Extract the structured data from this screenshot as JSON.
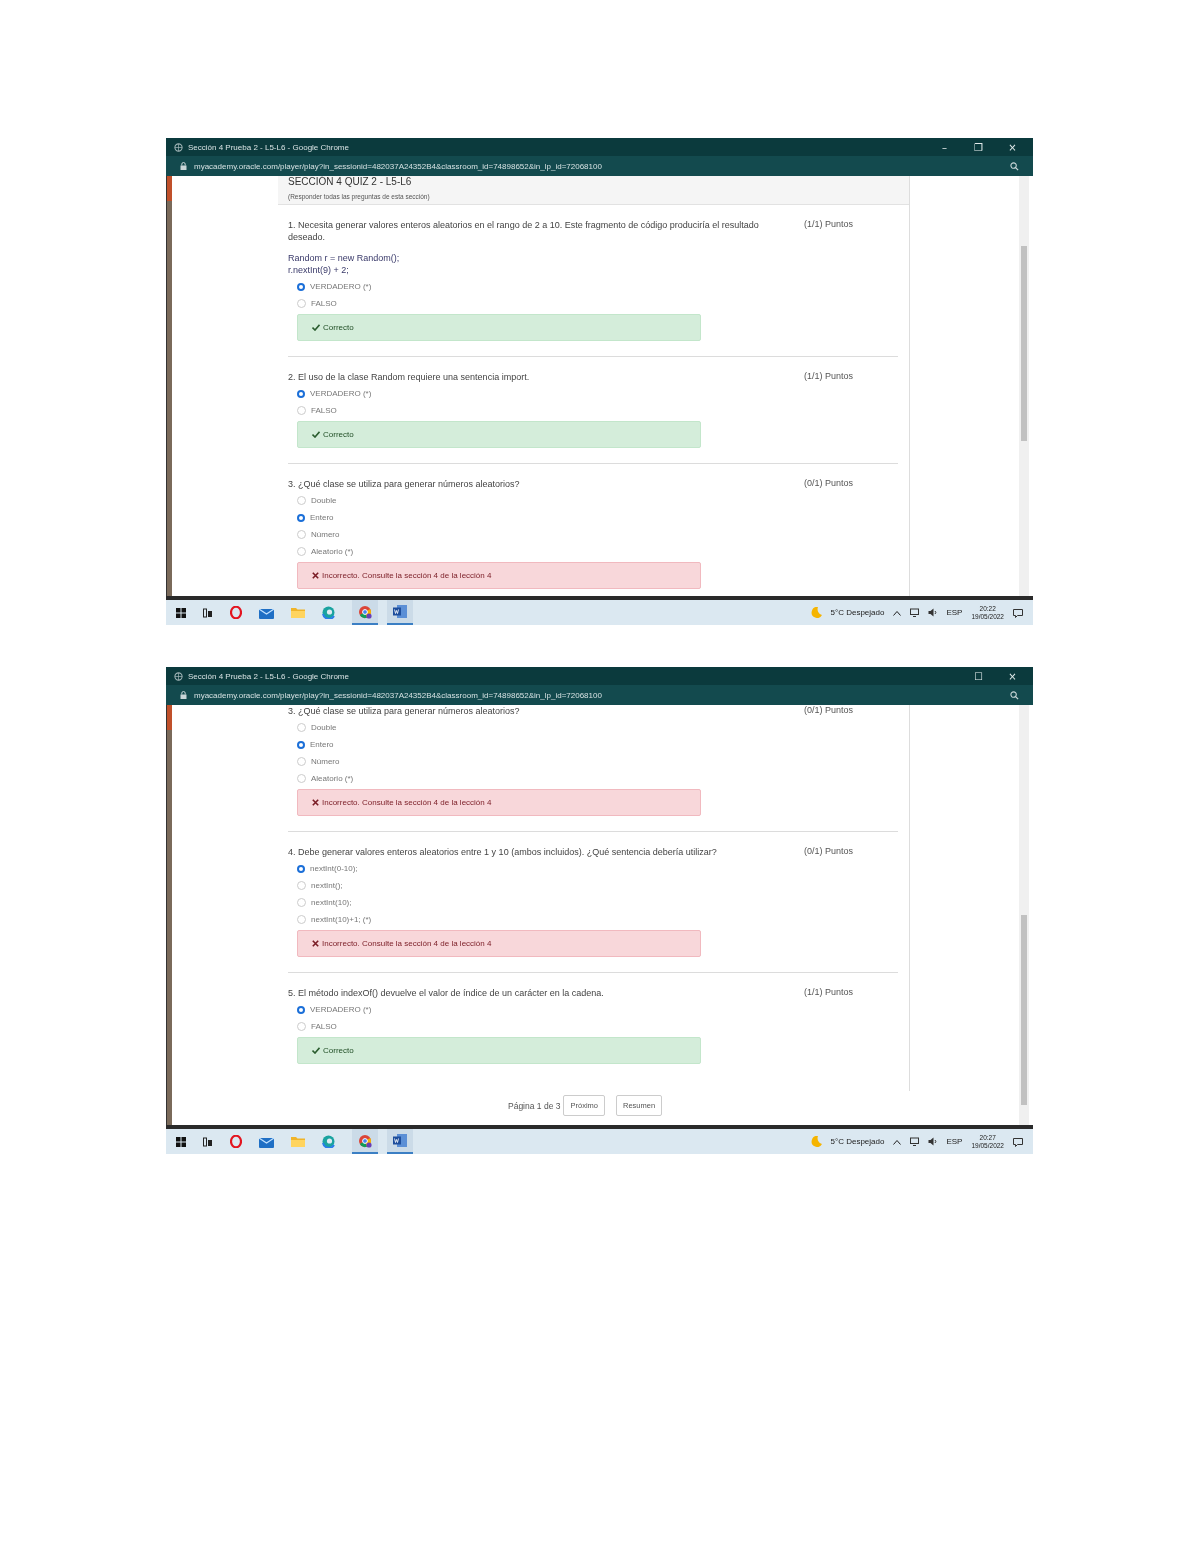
{
  "screenshots": [
    {
      "window": {
        "title": "Sección 4 Prueba 2 - L5-L6 - Google Chrome",
        "controls": [
          "–",
          "❐",
          "×"
        ]
      },
      "address": "myacademy.oracle.com/player/play?in_sessionid=482037A24352B4&classroom_id=74898652&in_lp_id=72068100",
      "header": {
        "title": "SECCIÓN 4 QUIZ 2 - L5-L6",
        "subtitle": "(Responder todas las preguntas de esta sección)"
      },
      "questions": [
        {
          "text": "1. Necesita generar valores enteros aleatorios en el rango de 2 a 10. Este fragmento de código produciría el resultado deseado.",
          "points": "(1/1) Puntos",
          "code": [
            "Random r = new Random();",
            "r.nextInt(9) + 2;"
          ],
          "options": [
            {
              "label": "VERDADERO (*)",
              "selected": true
            },
            {
              "label": "FALSO",
              "selected": false
            }
          ],
          "feedback": {
            "kind": "correct",
            "text": "Correcto"
          }
        },
        {
          "text": "2. El uso de la clase Random requiere una sentencia import.",
          "points": "(1/1) Puntos",
          "options": [
            {
              "label": "VERDADERO (*)",
              "selected": true
            },
            {
              "label": "FALSO",
              "selected": false
            }
          ],
          "feedback": {
            "kind": "correct",
            "text": "Correcto"
          }
        },
        {
          "text": "3. ¿Qué clase se utiliza para generar números aleatorios?",
          "points": "(0/1) Puntos",
          "options": [
            {
              "label": "Double",
              "selected": false
            },
            {
              "label": "Entero",
              "selected": true
            },
            {
              "label": "Número",
              "selected": false
            },
            {
              "label": "Aleatorio (*)",
              "selected": false
            }
          ],
          "feedback": {
            "kind": "incorrect",
            "text": "Incorrecto. Consulte la sección 4 de la lección 4"
          }
        }
      ],
      "taskbar": {
        "weather": "5°C Despejado",
        "language": "ESP",
        "time": "20:22",
        "date": "19/05/2022"
      }
    },
    {
      "window": {
        "title": "Sección 4 Prueba 2 - L5-L6 - Google Chrome",
        "controls": [
          "☐",
          "×"
        ]
      },
      "address": "myacademy.oracle.com/player/play?in_sessionid=482037A24352B4&classroom_id=74898652&in_lp_id=72068100",
      "questions": [
        {
          "text": "3. ¿Qué clase se utiliza para generar números aleatorios?",
          "points": "(0/1) Puntos",
          "options": [
            {
              "label": "Double",
              "selected": false
            },
            {
              "label": "Entero",
              "selected": true
            },
            {
              "label": "Número",
              "selected": false
            },
            {
              "label": "Aleatorio (*)",
              "selected": false
            }
          ],
          "feedback": {
            "kind": "incorrect",
            "text": "Incorrecto. Consulte la sección 4 de la lección 4"
          }
        },
        {
          "text": "4. Debe generar valores enteros aleatorios entre 1 y 10 (ambos incluidos). ¿Qué sentencia debería utilizar?",
          "points": "(0/1) Puntos",
          "options": [
            {
              "label": "nextInt(0-10);",
              "selected": true
            },
            {
              "label": "nextInt();",
              "selected": false
            },
            {
              "label": "nextInt(10);",
              "selected": false
            },
            {
              "label": "nextInt(10)+1; (*)",
              "selected": false
            }
          ],
          "feedback": {
            "kind": "incorrect",
            "text": "Incorrecto. Consulte la sección 4 de la lección 4"
          }
        },
        {
          "text": "5. El método indexOf() devuelve el valor de índice de un carácter en la cadena.",
          "points": "(1/1) Puntos",
          "options": [
            {
              "label": "VERDADERO (*)",
              "selected": true
            },
            {
              "label": "FALSO",
              "selected": false
            }
          ],
          "feedback": {
            "kind": "correct",
            "text": "Correcto"
          }
        }
      ],
      "pager": {
        "text": "Página 1 de 3",
        "buttons": [
          "Próximo",
          "Resumen"
        ]
      },
      "taskbar": {
        "weather": "5°C Despejado",
        "language": "ESP",
        "time": "20:27",
        "date": "19/05/2022"
      }
    }
  ]
}
